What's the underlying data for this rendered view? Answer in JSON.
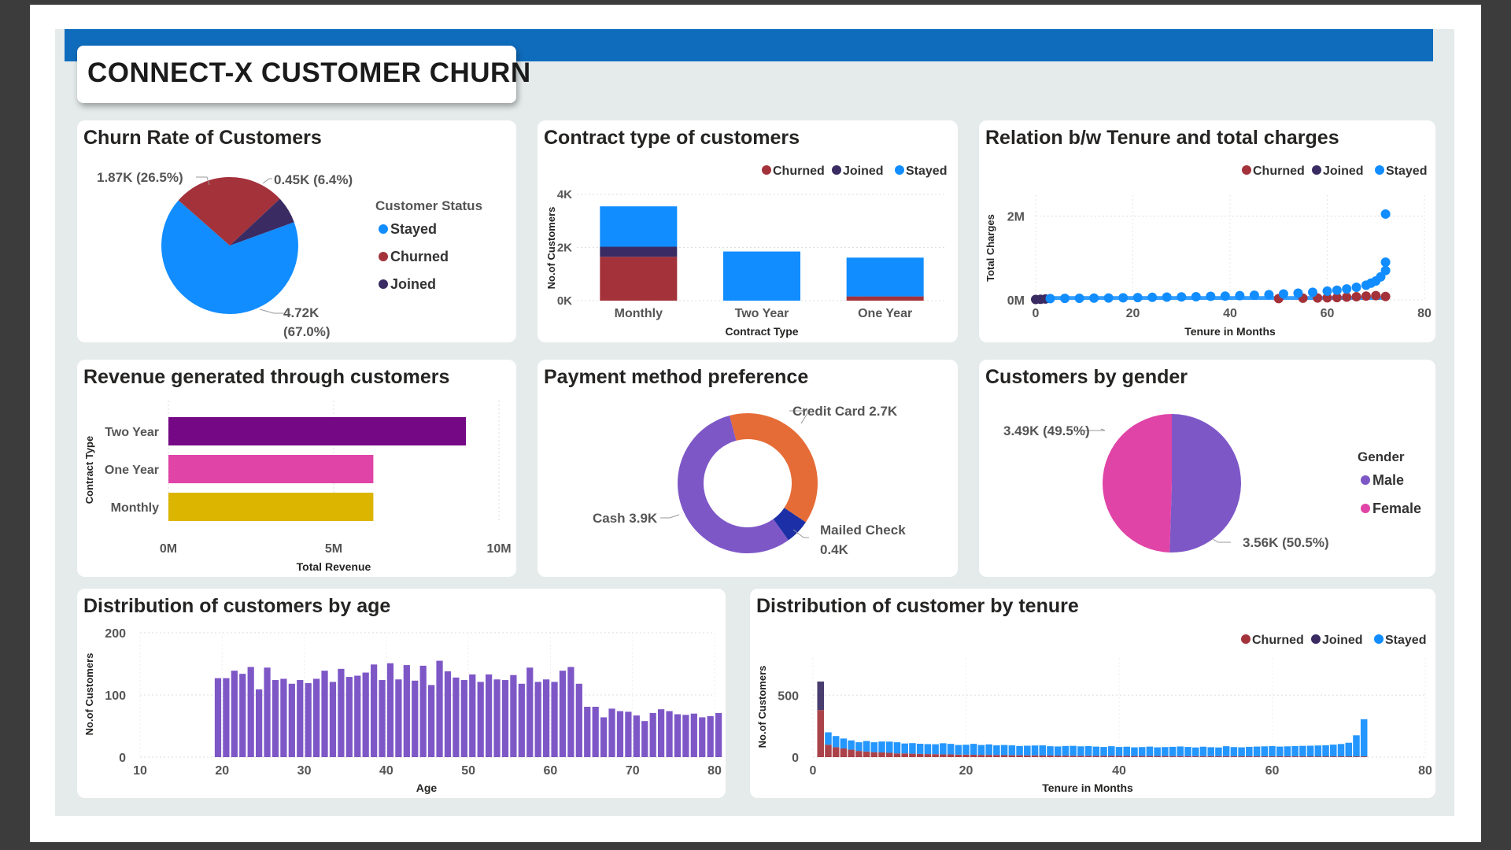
{
  "dashboard_title": "CONNECT-X CUSTOMER CHURN",
  "colors": {
    "stayed": "#118dff",
    "churned": "#a4323b",
    "joined": "#3a2b63",
    "header": "#0f6cbd",
    "purple": "#7e57c7",
    "magenta": "#e044a7",
    "gold": "#dcb500",
    "darkpurple": "#750985",
    "orange": "#e66c37",
    "navy": "#1c2fa6"
  },
  "chart_data": [
    {
      "id": "churn_rate",
      "type": "pie",
      "title": "Churn Rate of Customers",
      "legend_title": "Customer Status",
      "legend": [
        "Stayed",
        "Churned",
        "Joined"
      ],
      "slices": [
        {
          "label": "Stayed",
          "value": 4720,
          "text": "4.72K",
          "pct": "(67.0%)"
        },
        {
          "label": "Churned",
          "value": 1870,
          "text": "1.87K (26.5%)"
        },
        {
          "label": "Joined",
          "value": 450,
          "text": "0.45K (6.4%)"
        }
      ]
    },
    {
      "id": "contract_type",
      "type": "bar",
      "title": "Contract type of customers",
      "legend": [
        "Churned",
        "Joined",
        "Stayed"
      ],
      "xlabel": "Contract Type",
      "ylabel": "No.of Customers",
      "categories": [
        "Monthly",
        "Two Year",
        "One Year"
      ],
      "yticks": [
        "0K",
        "2K",
        "4K"
      ],
      "ylim": [
        0,
        4000
      ],
      "series": [
        {
          "name": "Churned",
          "values": [
            1650,
            0,
            160
          ]
        },
        {
          "name": "Joined",
          "values": [
            380,
            0,
            0
          ]
        },
        {
          "name": "Stayed",
          "values": [
            1520,
            1850,
            1460
          ]
        }
      ]
    },
    {
      "id": "tenure_charges",
      "type": "scatter",
      "title": "Relation b/w Tenure and total charges",
      "legend": [
        "Churned",
        "Joined",
        "Stayed"
      ],
      "xlabel": "Tenure in Months",
      "ylabel": "Total Charges",
      "xticks": [
        "0",
        "20",
        "40",
        "60",
        "80"
      ],
      "yticks": [
        "0M",
        "2M"
      ],
      "xlim": [
        0,
        80
      ],
      "ylim": [
        0,
        2500000
      ],
      "series": [
        {
          "name": "Joined",
          "x": [
            0,
            1,
            2
          ],
          "y": [
            10000,
            15000,
            20000
          ]
        },
        {
          "name": "Churned",
          "x": [
            50,
            55,
            58,
            60,
            62,
            64,
            66,
            68,
            70,
            72
          ],
          "y": [
            30000,
            40000,
            45000,
            50000,
            55000,
            65000,
            75000,
            90000,
            100000,
            80000
          ]
        },
        {
          "name": "Stayed",
          "x": [
            3,
            6,
            9,
            12,
            15,
            18,
            21,
            24,
            27,
            30,
            33,
            36,
            39,
            42,
            45,
            48,
            51,
            54,
            57,
            60,
            62,
            64,
            66,
            68,
            69,
            70,
            71,
            72,
            72,
            72
          ],
          "y": [
            30000,
            35000,
            38000,
            42000,
            45000,
            50000,
            55000,
            60000,
            65000,
            70000,
            75000,
            85000,
            90000,
            100000,
            110000,
            125000,
            140000,
            160000,
            180000,
            210000,
            230000,
            260000,
            300000,
            350000,
            400000,
            450000,
            550000,
            700000,
            900000,
            2050000
          ]
        }
      ]
    },
    {
      "id": "revenue",
      "type": "bar",
      "orientation": "horizontal",
      "title": "Revenue generated through customers",
      "xlabel": "Total Revenue",
      "ylabel": "Contract Type",
      "categories": [
        "Two Year",
        "One Year",
        "Monthly"
      ],
      "values": [
        9000000,
        6200000,
        6200000
      ],
      "xticks": [
        "0M",
        "5M",
        "10M"
      ],
      "xlim": [
        0,
        10000000
      ]
    },
    {
      "id": "payment",
      "type": "pie",
      "variant": "donut",
      "title": "Payment method preference",
      "slices": [
        {
          "label": "Credit Card",
          "value": 2700,
          "text": "Credit Card 2.7K"
        },
        {
          "label": "Mailed Check",
          "value": 400,
          "text": "Mailed Check",
          "text2": "0.4K"
        },
        {
          "label": "Cash",
          "value": 3900,
          "text": "Cash 3.9K"
        }
      ]
    },
    {
      "id": "gender",
      "type": "pie",
      "title": "Customers by gender",
      "legend_title": "Gender",
      "legend": [
        "Male",
        "Female"
      ],
      "slices": [
        {
          "label": "Male",
          "value": 3560,
          "text": "3.56K (50.5%)"
        },
        {
          "label": "Female",
          "value": 3490,
          "text": "3.49K (49.5%)"
        }
      ]
    },
    {
      "id": "age_dist",
      "type": "bar",
      "title": "Distribution of customers by age",
      "xlabel": "Age",
      "ylabel": "No.of Customers",
      "xticks": [
        "10",
        "20",
        "30",
        "40",
        "50",
        "60",
        "70",
        "80"
      ],
      "yticks": [
        "0",
        "100",
        "200"
      ],
      "xlim": [
        10,
        80
      ],
      "ylim": [
        0,
        200
      ],
      "x_start": 19,
      "values": [
        127,
        127,
        139,
        134,
        145,
        109,
        144,
        124,
        126,
        118,
        124,
        119,
        126,
        139,
        121,
        142,
        129,
        131,
        136,
        149,
        124,
        151,
        125,
        148,
        123,
        147,
        116,
        155,
        138,
        128,
        124,
        133,
        121,
        133,
        125,
        124,
        132,
        118,
        144,
        121,
        125,
        121,
        139,
        145,
        118,
        81,
        81,
        64,
        78,
        74,
        73,
        67,
        58,
        71,
        77,
        74,
        69,
        68,
        70,
        64,
        66,
        71,
        67,
        78,
        71,
        66,
        64,
        64,
        75,
        74,
        66,
        74,
        60,
        68,
        63,
        65,
        58,
        68,
        61,
        67,
        62,
        70,
        69,
        67,
        64,
        66,
        64,
        69,
        60,
        58,
        73,
        72,
        66,
        67,
        63,
        64,
        66,
        67,
        63,
        66,
        67,
        60,
        72,
        65,
        67,
        62,
        63,
        67,
        62,
        60
      ]
    },
    {
      "id": "tenure_dist",
      "type": "bar",
      "stacked": true,
      "title": "Distribution of customer by tenure",
      "legend": [
        "Churned",
        "Joined",
        "Stayed"
      ],
      "xlabel": "Tenure in Months",
      "ylabel": "No.of Customers",
      "xticks": [
        "0",
        "20",
        "40",
        "60",
        "80"
      ],
      "yticks": [
        "0",
        "500"
      ],
      "xlim": [
        0,
        80
      ],
      "ylim": [
        0,
        800
      ],
      "x_start": 1,
      "series": [
        {
          "name": "Churned",
          "values": [
            380,
            100,
            80,
            70,
            60,
            50,
            45,
            40,
            38,
            35,
            30,
            30,
            28,
            26,
            25,
            24,
            22,
            22,
            20,
            20,
            19,
            18,
            18,
            17,
            16,
            15,
            15,
            14,
            14,
            13,
            13,
            12,
            12,
            11,
            11,
            11,
            10,
            10,
            10,
            10,
            10,
            9,
            9,
            9,
            9,
            9,
            8,
            8,
            8,
            8,
            8,
            8,
            8,
            8,
            7,
            7,
            7,
            7,
            7,
            7,
            7,
            7,
            7,
            7,
            6,
            6,
            6,
            6,
            6,
            6,
            6,
            6
          ]
        },
        {
          "name": "Joined",
          "values": [
            230,
            0,
            0,
            0,
            0,
            0,
            0,
            0,
            0,
            0,
            0,
            0,
            0,
            0,
            0,
            0,
            0,
            0,
            0,
            0,
            0,
            0,
            0,
            0,
            0,
            0,
            0,
            0,
            0,
            0,
            0,
            0,
            0,
            0,
            0,
            0,
            0,
            0,
            0,
            0,
            0,
            0,
            0,
            0,
            0,
            0,
            0,
            0,
            0,
            0,
            0,
            0,
            0,
            0,
            0,
            0,
            0,
            0,
            0,
            0,
            0,
            0,
            0,
            0,
            0,
            0,
            0,
            0,
            0,
            0,
            0,
            0
          ]
        },
        {
          "name": "Stayed",
          "values": [
            0,
            100,
            90,
            80,
            75,
            70,
            85,
            80,
            88,
            90,
            90,
            80,
            85,
            82,
            80,
            80,
            90,
            85,
            78,
            80,
            88,
            80,
            85,
            78,
            82,
            80,
            75,
            78,
            80,
            82,
            75,
            74,
            78,
            80,
            76,
            78,
            75,
            72,
            78,
            72,
            74,
            70,
            72,
            76,
            70,
            72,
            75,
            78,
            74,
            70,
            76,
            72,
            70,
            80,
            74,
            72,
            76,
            78,
            80,
            82,
            78,
            80,
            82,
            84,
            86,
            88,
            90,
            95,
            100,
            110,
            170,
            300
          ]
        }
      ]
    }
  ]
}
